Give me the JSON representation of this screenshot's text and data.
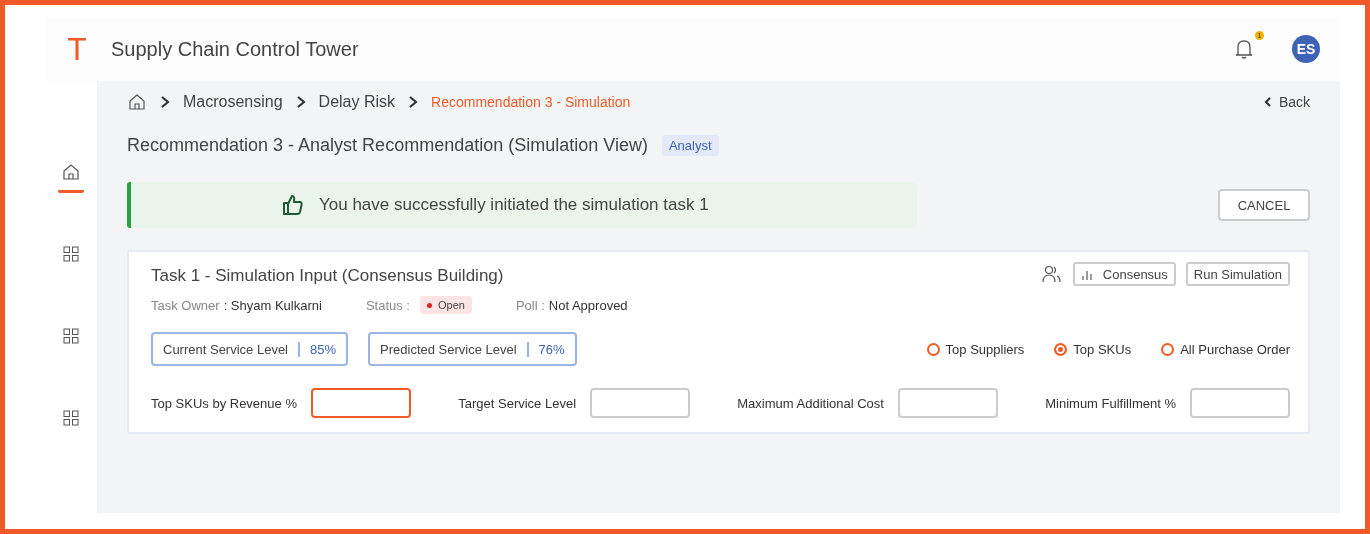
{
  "app": {
    "logo": "T",
    "title": "Supply Chain Control Tower",
    "notification_count": "1",
    "avatar_initials": "ES"
  },
  "sidebar": {
    "items": [
      {
        "kind": "home",
        "selected": true
      },
      {
        "kind": "grid",
        "selected": false
      },
      {
        "kind": "grid",
        "selected": false
      },
      {
        "kind": "grid",
        "selected": false
      }
    ]
  },
  "breadcrumb": [
    "Macrosensing",
    "Delay Risk",
    "Recommendation 3 - Simulation"
  ],
  "back": "Back",
  "page_title": "Recommendation 3 - Analyst Recommendation (Simulation View)",
  "role_badge": "Analyst",
  "alert": {
    "message": "You have successfully initiated the simulation task 1"
  },
  "cancel_button": "CANCEL",
  "task": {
    "title": "Task 1 - Simulation Input (Consensus Building)",
    "buttons": [
      {
        "label": "Consensus",
        "kind": "chart"
      },
      {
        "label": "Run Simulation",
        "kind": "plain"
      }
    ],
    "owner_label": "Task Owner",
    "owner": ": Shyam Kulkarni",
    "status_label": "Status :",
    "status": "Open",
    "poll_label": "Poll :",
    "poll": "Not Approved",
    "metrics": [
      {
        "label": "Current Service Level",
        "value": "85%"
      },
      {
        "label": "Predicted Service Level",
        "value": "76%"
      }
    ],
    "options": [
      {
        "label": "Top Suppliers",
        "selected": false
      },
      {
        "label": "Top SKUs",
        "selected": true
      },
      {
        "label": "All Purchase Order",
        "selected": false
      }
    ],
    "fields": [
      {
        "label": "Top SKUs by Revenue %",
        "focused": true
      },
      {
        "label": "Target Service Level",
        "focused": false
      },
      {
        "label": "Maximum Additional Cost",
        "focused": false
      },
      {
        "label": "Minimum Fulfillment %",
        "focused": false
      }
    ]
  }
}
